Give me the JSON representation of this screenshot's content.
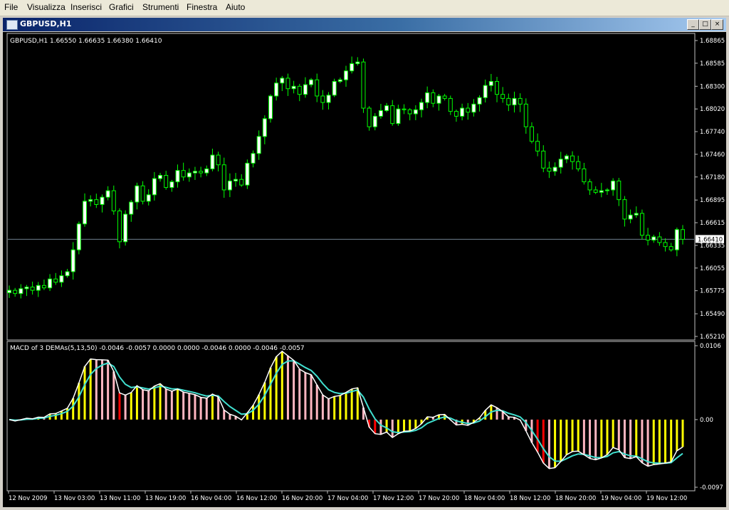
{
  "menu": {
    "items": [
      "File",
      "Visualizza",
      "Inserisci",
      "Grafici",
      "Strumenti",
      "Finestra",
      "Aiuto"
    ]
  },
  "window": {
    "title": "GBPUSD,H1",
    "buttons": [
      "minimize",
      "restore",
      "close"
    ]
  },
  "main_chart": {
    "header": "GBPUSD,H1  1.66550 1.66635 1.66380 1.66410",
    "price_labels": [
      "1.68865",
      "1.68585",
      "1.68300",
      "1.68020",
      "1.67740",
      "1.67460",
      "1.67180",
      "1.66895",
      "1.66615",
      "1.66335",
      "1.66055",
      "1.65775",
      "1.65490",
      "1.65210"
    ],
    "current_price": "1.66410"
  },
  "indicator": {
    "header": "MACD of 3 DEMAs(5,13,50) -0.0046 -0.0057 0.0000 0.0000 -0.0046 0.0000 -0.0046 -0.0057",
    "scale_labels": [
      "0.0106",
      "0.00",
      "-0.0097"
    ]
  },
  "time_axis": [
    "12 Nov 2009",
    "13 Nov 03:00",
    "13 Nov 11:00",
    "13 Nov 19:00",
    "16 Nov 04:00",
    "16 Nov 12:00",
    "16 Nov 20:00",
    "17 Nov 04:00",
    "17 Nov 12:00",
    "17 Nov 20:00",
    "18 Nov 04:00",
    "18 Nov 12:00",
    "18 Nov 20:00",
    "19 Nov 04:00",
    "19 Nov 12:00"
  ],
  "colors": {
    "candle": "#00ff00",
    "candle_bull_body": "#ffffff",
    "bid_line": "#708090",
    "hist_yellow": "#ffff00",
    "hist_pink": "#ffb6c1",
    "hist_red": "#ff0000",
    "macd_line": "#ffffff",
    "signal_line": "#40e0d0"
  },
  "chart_data": {
    "type": "candlestick",
    "symbol": "GBPUSD",
    "timeframe": "H1",
    "close": [
      1.6578,
      1.6574,
      1.658,
      1.6582,
      1.6578,
      1.6584,
      1.6581,
      1.6592,
      1.6588,
      1.6596,
      1.6601,
      1.6628,
      1.666,
      1.6688,
      1.669,
      1.6684,
      1.6693,
      1.6701,
      1.6676,
      1.6638,
      1.6672,
      1.6687,
      1.6707,
      1.6688,
      1.6696,
      1.6716,
      1.672,
      1.6705,
      1.6712,
      1.6726,
      1.6718,
      1.6723,
      1.6725,
      1.6723,
      1.6728,
      1.6745,
      1.6733,
      1.6702,
      1.6713,
      1.6715,
      1.6708,
      1.6735,
      1.6747,
      1.6768,
      1.679,
      1.6818,
      1.6834,
      1.684,
      1.6827,
      1.683,
      1.682,
      1.6832,
      1.6838,
      1.6818,
      1.681,
      1.6819,
      1.6836,
      1.6838,
      1.6849,
      1.6858,
      1.686,
      1.6803,
      1.678,
      1.6793,
      1.68,
      1.6806,
      1.6784,
      1.6802,
      1.6801,
      1.6796,
      1.6801,
      1.681,
      1.6822,
      1.6809,
      1.6818,
      1.6815,
      1.6799,
      1.6793,
      1.6803,
      1.6798,
      1.6808,
      1.6816,
      1.6831,
      1.6836,
      1.682,
      1.6815,
      1.6807,
      1.6815,
      1.6808,
      1.678,
      1.6762,
      1.675,
      1.6729,
      1.6725,
      1.673,
      1.674,
      1.6744,
      1.6737,
      1.6728,
      1.6712,
      1.6702,
      1.6699,
      1.6701,
      1.6702,
      1.6713,
      1.669,
      1.6666,
      1.6671,
      1.6673,
      1.6646,
      1.664,
      1.6644,
      1.6637,
      1.6632,
      1.6628,
      1.6653,
      1.6641
    ],
    "y_axis_range": [
      1.6521,
      1.68865
    ],
    "indicator_name": "MACD of 3 DEMAs(5,13,50)",
    "indicator_range": [
      -0.0097,
      0.0106
    ]
  }
}
